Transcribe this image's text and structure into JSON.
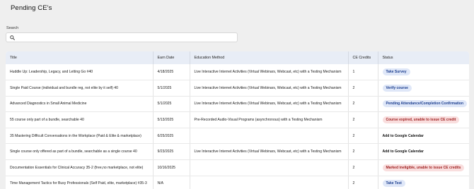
{
  "page": {
    "title": "Pending CE's"
  },
  "search": {
    "label": "Search",
    "placeholder": "",
    "value": ""
  },
  "table": {
    "headers": {
      "title": "Title",
      "earn_date": "Earn Date",
      "education_method": "Education Method",
      "ce_credits": "CE Credits",
      "status": "Status"
    },
    "rows": [
      {
        "title": "Huddle Up: Leadership, Legacy, and Letting Go #40",
        "earn_date": "4/18/2025",
        "education_method": "Live Interactive Internet Activities (Virtual Webinars, Webcast, etc) with a Testing Mechanism",
        "ce_credits": "1",
        "status": "Take Survey",
        "status_style": "blue"
      },
      {
        "title": "Single Paid Course (individual and bundle reg, not elite by it self) 40",
        "earn_date": "5/1/2025",
        "education_method": "Live Interactive Internet Activities (Virtual Webinars, Webcast, etc) with a Testing Mechanism",
        "ce_credits": "2",
        "status": "Verify course",
        "status_style": "blue"
      },
      {
        "title": "Advanced Diagnostics in Small Animal Medicine",
        "earn_date": "5/1/2025",
        "education_method": "Live Interactive Internet Activities (Virtual Webinars, Webcast, etc) with a Testing Mechanism",
        "ce_credits": "2",
        "status": "Pending Attendance/Completion Confirmation",
        "status_style": "blue"
      },
      {
        "title": "55 course only part of a bundle, searchable 40",
        "earn_date": "5/13/2025",
        "education_method": "Pre-Recorded Audio-Visual Programs (asynchronous) with a Testing Mechanism",
        "ce_credits": "2",
        "status": "Course expired, unable to issue CE credit",
        "status_style": "red"
      },
      {
        "title": "35 Mastering Difficult Conversations in the Workplace (Paid & Elite & marketplace)",
        "earn_date": "6/25/2025",
        "education_method": "",
        "ce_credits": "2",
        "status": "Add to Google Calendar",
        "status_style": "link"
      },
      {
        "title": "Single course only offered as part of a bundle, searchable as a single course 40",
        "earn_date": "9/23/2025",
        "education_method": "Live Interactive Internet Activities (Virtual Webinars, Webcast, etc) with a Testing Mechanism",
        "ce_credits": "2",
        "status": "Add to Google Calendar",
        "status_style": "link"
      },
      {
        "title": "Documentation Essentials for Clinical Accuracy 35-2 (free,no marketplace, not elite)",
        "earn_date": "10/16/2025",
        "education_method": "",
        "ce_credits": "2",
        "status": "Marked ineligible, unable to issue CE credits",
        "status_style": "red"
      },
      {
        "title": "Time Management Tactics for Busy Professionals (Self Paid, elite, marketplace) #35-3",
        "earn_date": "N/A",
        "education_method": "",
        "ce_credits": "2",
        "status": "Take Test",
        "status_style": "blue"
      }
    ]
  }
}
